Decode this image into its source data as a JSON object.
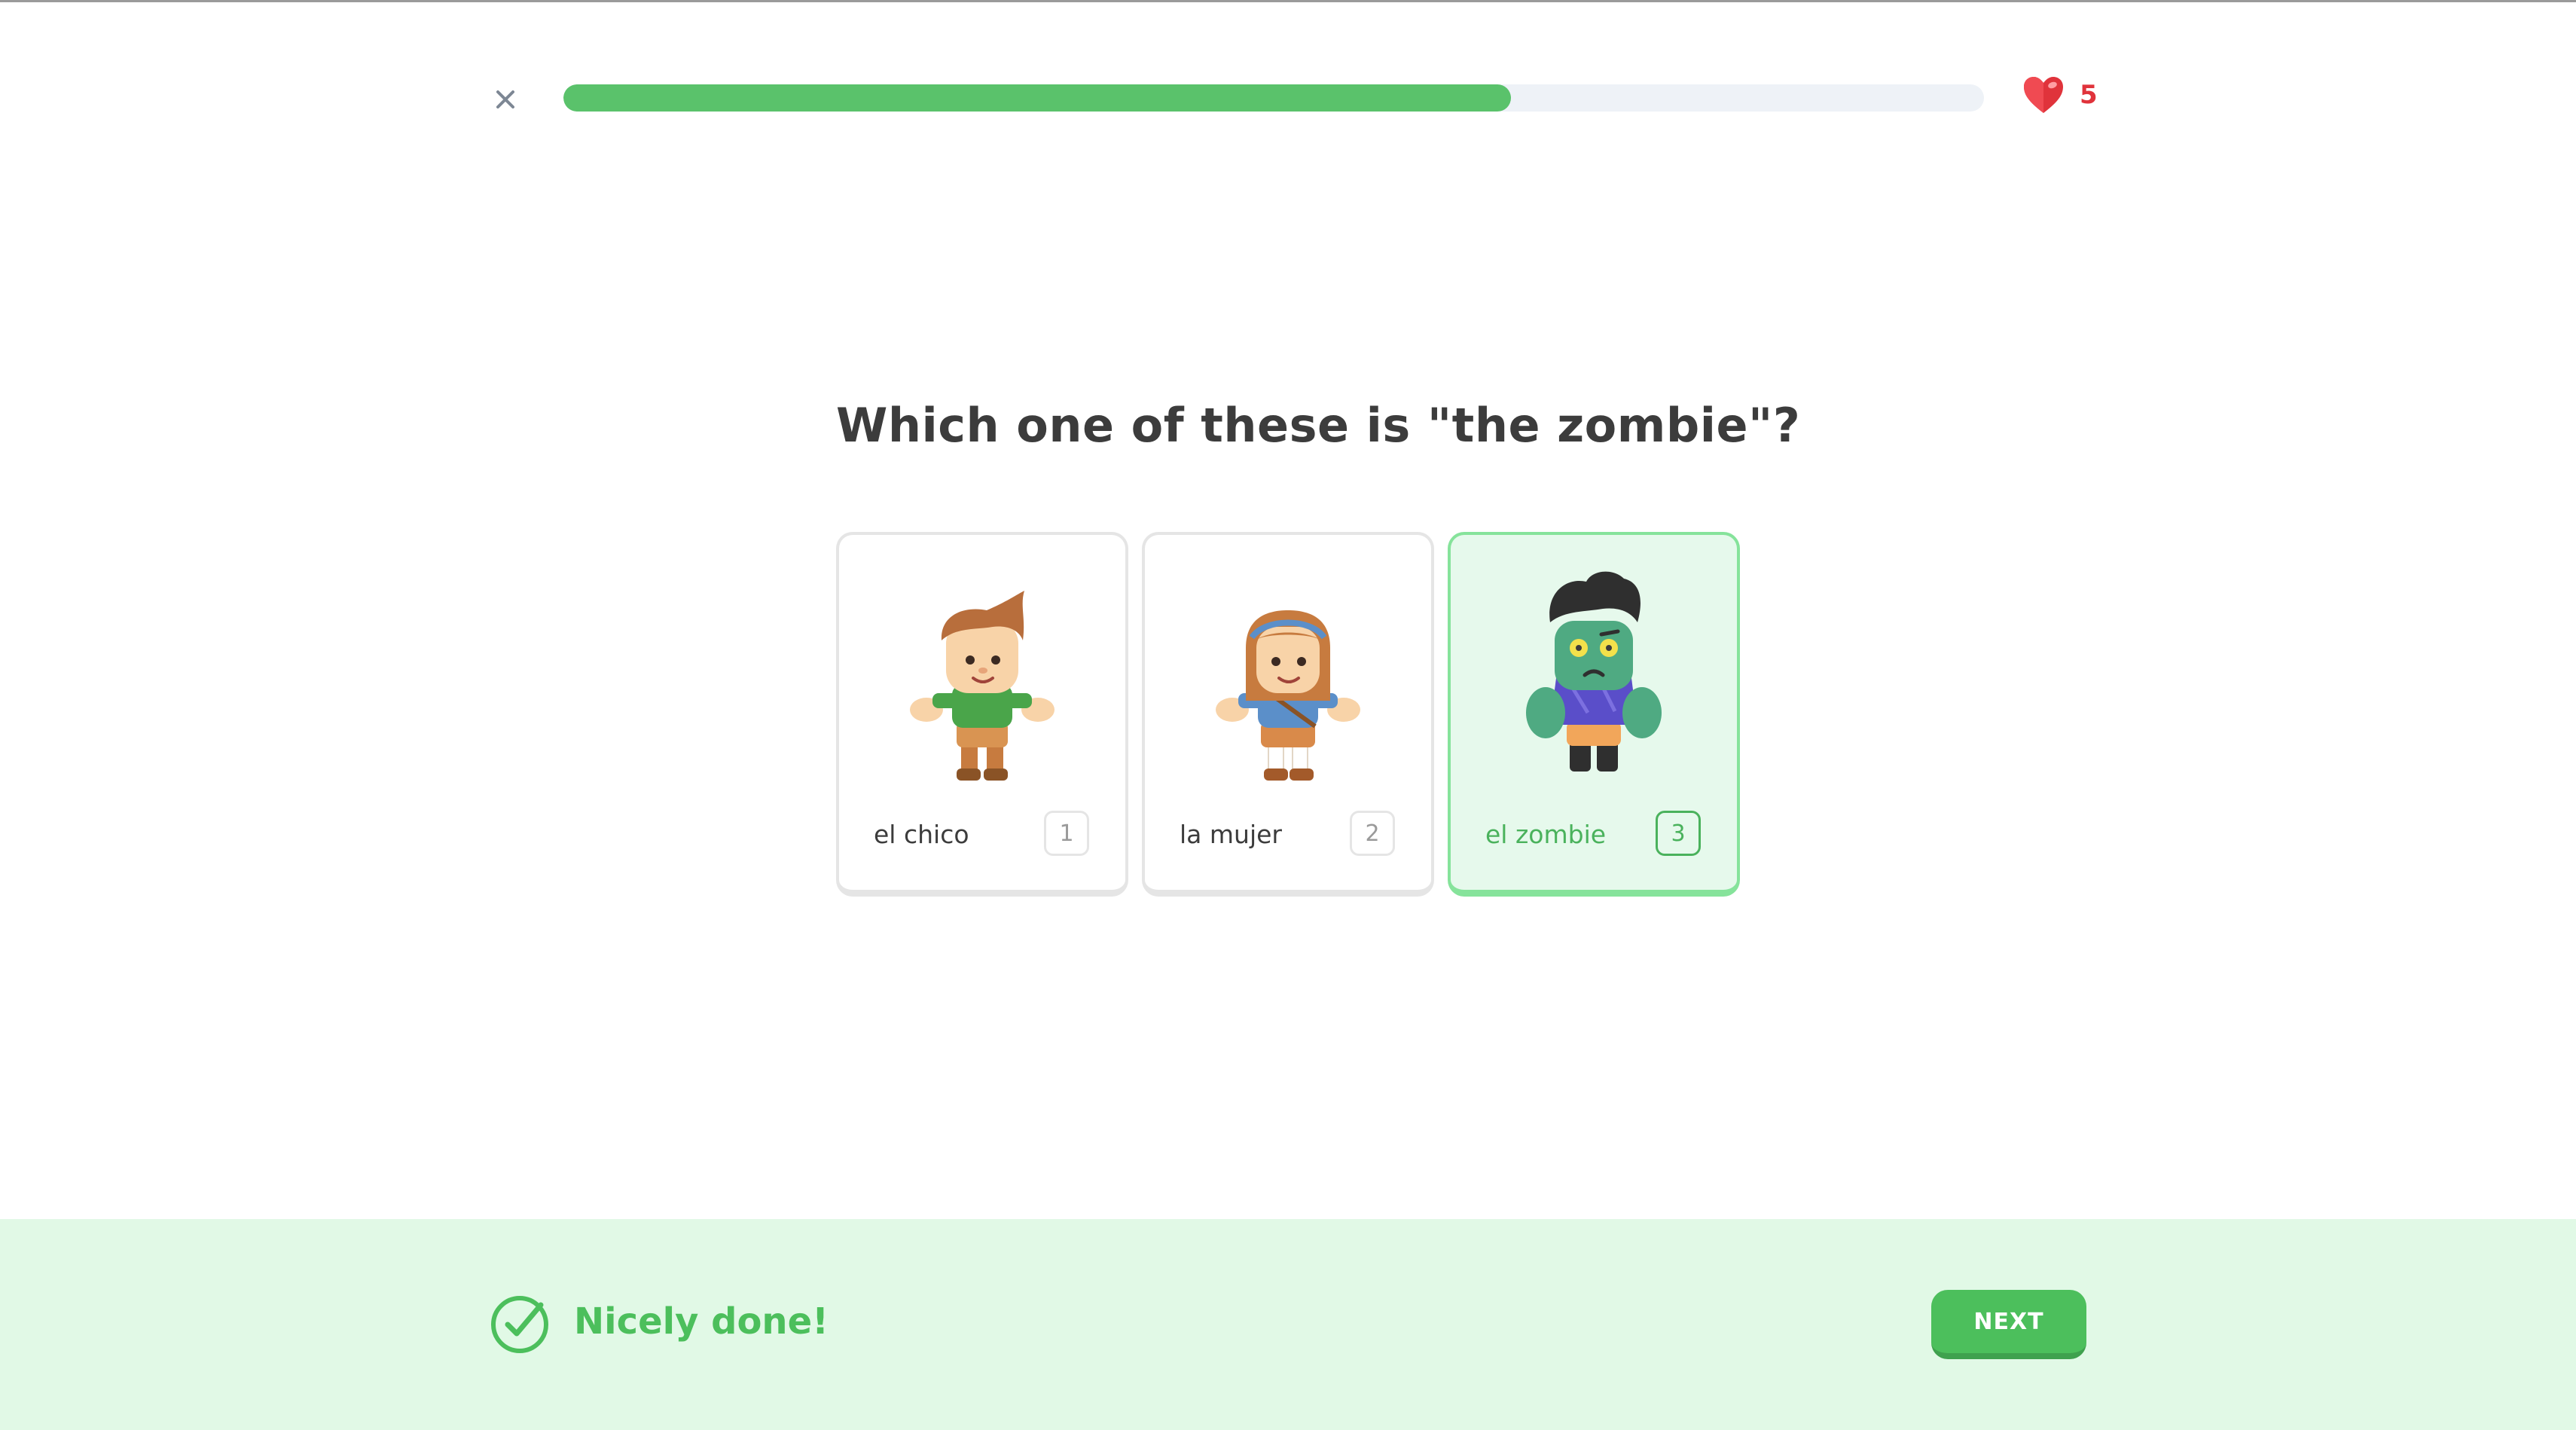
{
  "lesson": {
    "progress_fraction": 0.667,
    "hearts_count": "5"
  },
  "question": {
    "text": "Which one of these is \"the zombie\"?"
  },
  "choices": [
    {
      "label": "el chico",
      "key": "1",
      "selected": false
    },
    {
      "label": "la mujer",
      "key": "2",
      "selected": false
    },
    {
      "label": "el zombie",
      "key": "3",
      "selected": true
    }
  ],
  "footer": {
    "feedback": "Nicely done!",
    "next_label": "NEXT"
  },
  "icons": {
    "close": "close-icon",
    "hearts": "heart-icon",
    "check": "check-circle-icon"
  },
  "colors": {
    "accent_green": "#58cc02",
    "progress_green": "#5ac26b",
    "heart_red": "#e0333b",
    "footer_bg": "#e1f9e6",
    "selected_border": "#86e39b"
  }
}
